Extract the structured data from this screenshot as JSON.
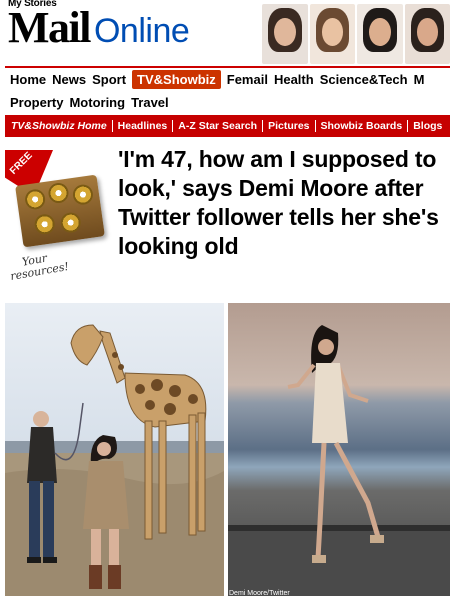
{
  "header": {
    "my_stories": "My Stories",
    "logo_main": "Mail",
    "logo_suffix": "Online"
  },
  "nav": {
    "row1": [
      "Home",
      "News",
      "Sport",
      "TV&Showbiz",
      "Femail",
      "Health",
      "Science&Tech",
      "M"
    ],
    "row2": [
      "Property",
      "Motoring",
      "Travel"
    ],
    "active": "TV&Showbiz"
  },
  "subnav": [
    "TV&Showbiz Home",
    "Headlines",
    "A-Z Star Search",
    "Pictures",
    "Showbiz Boards",
    "Blogs"
  ],
  "promo": {
    "badge": "FREE",
    "caption_line1": "Your",
    "caption_line2": "resources!"
  },
  "article": {
    "headline": "'I'm 47, how am I supposed to look,' says Demi Moore after Twitter follower tells her she's looking old"
  },
  "photos": {
    "right_credit": "Demi Moore/Twitter"
  },
  "colors": {
    "brand_red": "#c60000",
    "online_blue": "#004db3"
  }
}
